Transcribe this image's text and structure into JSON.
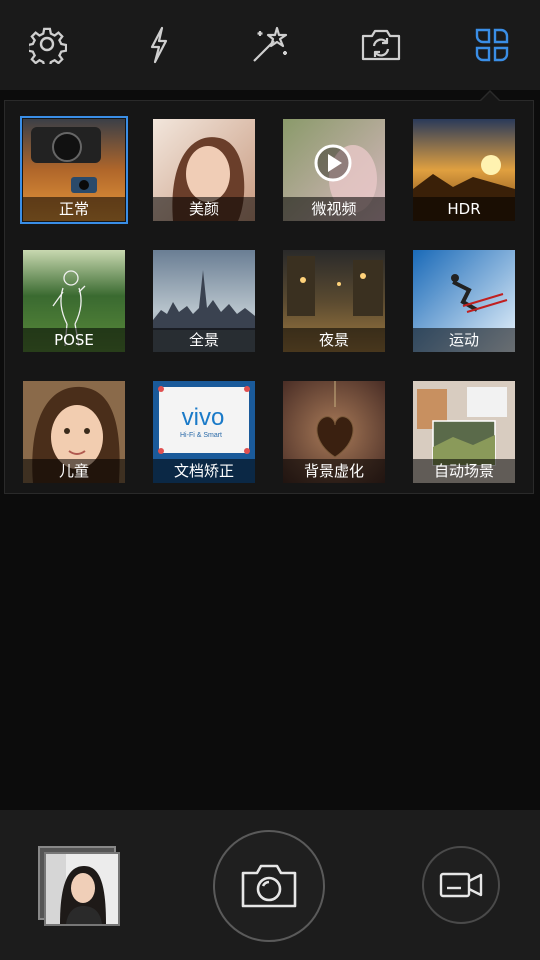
{
  "toolbar": {
    "items": [
      {
        "icon": "gear-icon",
        "active": false
      },
      {
        "icon": "flash-icon",
        "active": false
      },
      {
        "icon": "magic-wand-icon",
        "active": false
      },
      {
        "icon": "switch-camera-icon",
        "active": false
      },
      {
        "icon": "modes-grid-icon",
        "active": true
      }
    ],
    "active_color": "#3a8ee6",
    "icon_color": "#cfcfcf"
  },
  "modes": [
    {
      "label": "正常",
      "selected": true
    },
    {
      "label": "美颜",
      "selected": false
    },
    {
      "label": "微视频",
      "selected": false
    },
    {
      "label": "HDR",
      "selected": false
    },
    {
      "label": "POSE",
      "selected": false
    },
    {
      "label": "全景",
      "selected": false
    },
    {
      "label": "夜景",
      "selected": false
    },
    {
      "label": "运动",
      "selected": false
    },
    {
      "label": "儿童",
      "selected": false
    },
    {
      "label": "文档矫正",
      "selected": false
    },
    {
      "label": "背景虚化",
      "selected": false
    },
    {
      "label": "自动场景",
      "selected": false
    }
  ],
  "document_thumb": {
    "brand": "vivo",
    "tagline": "Hi-Fi & Smart"
  },
  "bottom": {
    "gallery_icon": "gallery-thumbnail",
    "shutter_icon": "camera-icon",
    "video_icon": "video-camera-icon"
  }
}
